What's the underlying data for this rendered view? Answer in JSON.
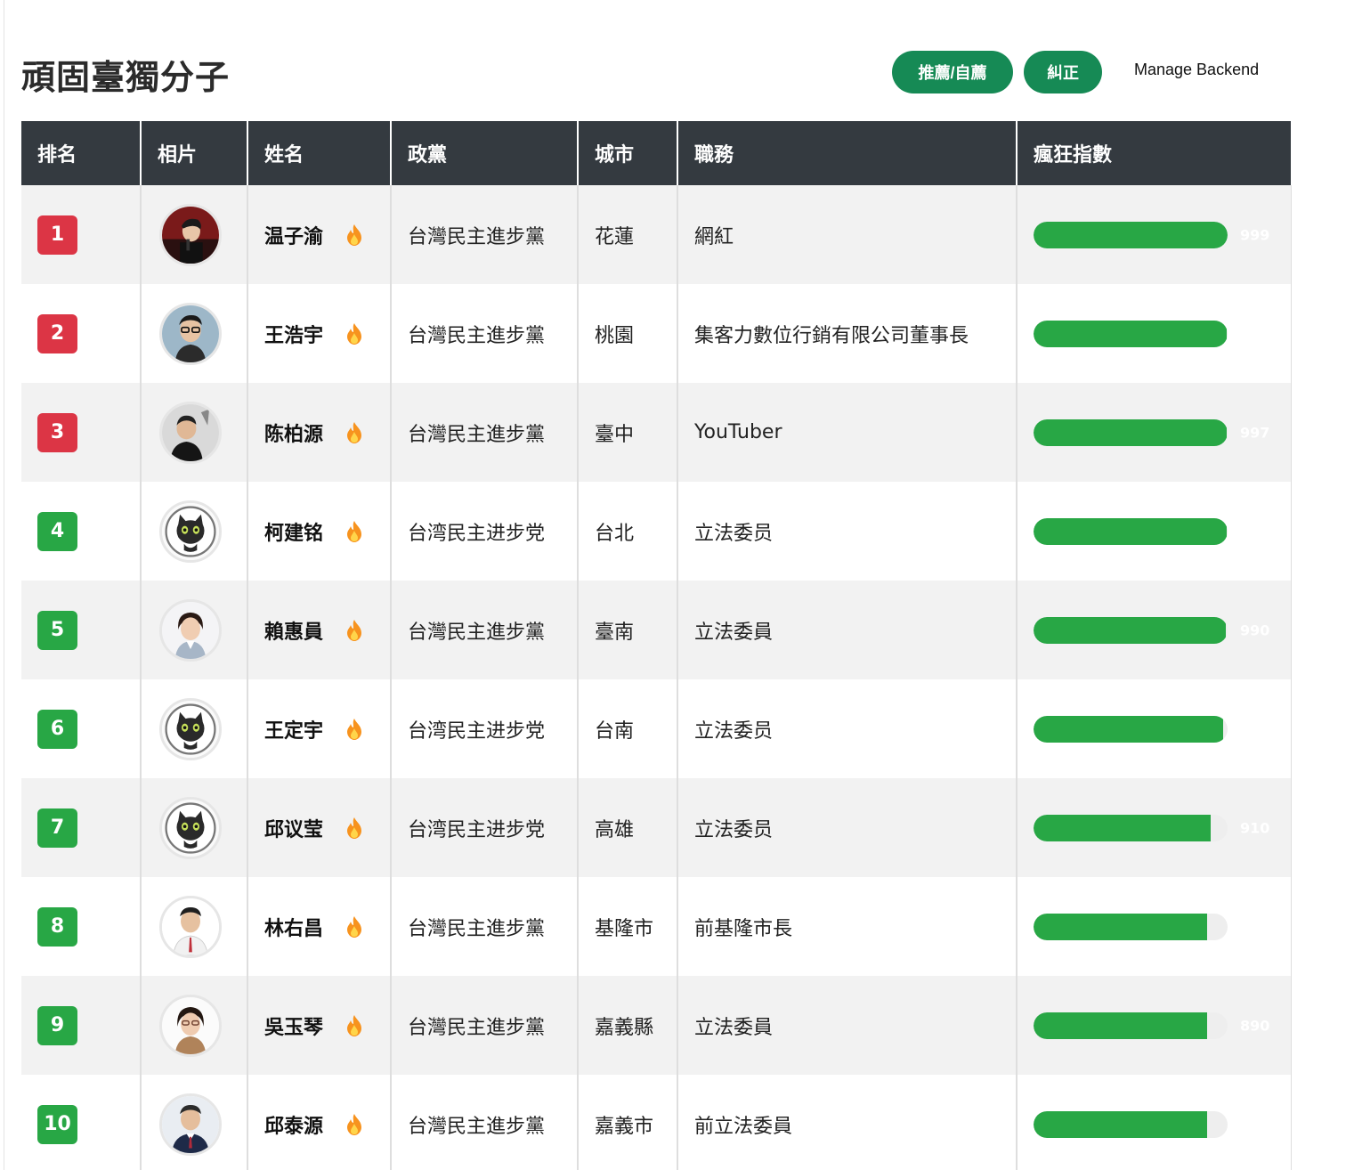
{
  "header": {
    "title": "頑固臺獨分子",
    "recommend_label": "推薦/自薦",
    "correct_label": "糾正",
    "backend_label": "Manage Backend"
  },
  "table": {
    "columns": [
      "排名",
      "相片",
      "姓名",
      "政黨",
      "城市",
      "職務",
      "瘋狂指數"
    ],
    "rows": [
      {
        "rank": "1",
        "name": "温子渝",
        "party": "台灣民主進步黨",
        "city": "花蓮",
        "role": "網紅",
        "score_label": "999",
        "score": 1.0,
        "avatar": "photo-male-singer",
        "rank_color": "#dc3545"
      },
      {
        "rank": "2",
        "name": "王浩宇",
        "party": "台灣民主進步黨",
        "city": "桃園",
        "role": "集客力數位行銷有限公司董事長",
        "score_label": "",
        "score": 0.995,
        "avatar": "photo-male-glasses",
        "rank_color": "#dc3545"
      },
      {
        "rank": "3",
        "name": "陈柏源",
        "party": "台灣民主進步黨",
        "city": "臺中",
        "role": "YouTuber",
        "score_label": "997",
        "score": 0.995,
        "avatar": "photo-male-stage",
        "rank_color": "#dc3545"
      },
      {
        "rank": "4",
        "name": "柯建铭",
        "party": "台湾民主进步党",
        "city": "台北",
        "role": "立法委员",
        "score_label": "",
        "score": 0.995,
        "avatar": "black-cat-icon",
        "rank_color": "#28a745"
      },
      {
        "rank": "5",
        "name": "賴惠員",
        "party": "台灣民主進步黨",
        "city": "臺南",
        "role": "立法委員",
        "score_label": "990",
        "score": 0.99,
        "avatar": "photo-female-short-hair",
        "rank_color": "#28a745"
      },
      {
        "rank": "6",
        "name": "王定宇",
        "party": "台湾民主进步党",
        "city": "台南",
        "role": "立法委员",
        "score_label": "",
        "score": 0.975,
        "avatar": "black-cat-icon",
        "rank_color": "#28a745"
      },
      {
        "rank": "7",
        "name": "邱议莹",
        "party": "台湾民主进步党",
        "city": "高雄",
        "role": "立法委员",
        "score_label": "910",
        "score": 0.915,
        "avatar": "black-cat-icon",
        "rank_color": "#28a745"
      },
      {
        "rank": "8",
        "name": "林右昌",
        "party": "台灣民主進步黨",
        "city": "基隆市",
        "role": "前基隆市長",
        "score_label": "",
        "score": 0.895,
        "avatar": "photo-male-white-shirt",
        "rank_color": "#28a745"
      },
      {
        "rank": "9",
        "name": "吳玉琴",
        "party": "台灣民主進步黨",
        "city": "嘉義縣",
        "role": "立法委員",
        "score_label": "890",
        "score": 0.895,
        "avatar": "photo-female-glasses",
        "rank_color": "#28a745"
      },
      {
        "rank": "10",
        "name": "邱泰源",
        "party": "台灣民主進步黨",
        "city": "嘉義市",
        "role": "前立法委員",
        "score_label": "",
        "score": 0.895,
        "avatar": "photo-male-suit",
        "rank_color": "#28a745"
      }
    ]
  },
  "colors": {
    "brand_button": "#168a55",
    "header_bg": "#343a40",
    "rank_top": "#dc3545",
    "rank_rest": "#28a745",
    "bar_fill": "#28a745",
    "flame": "#f7931e"
  },
  "icons": {
    "row_badge": "flame-icon"
  }
}
